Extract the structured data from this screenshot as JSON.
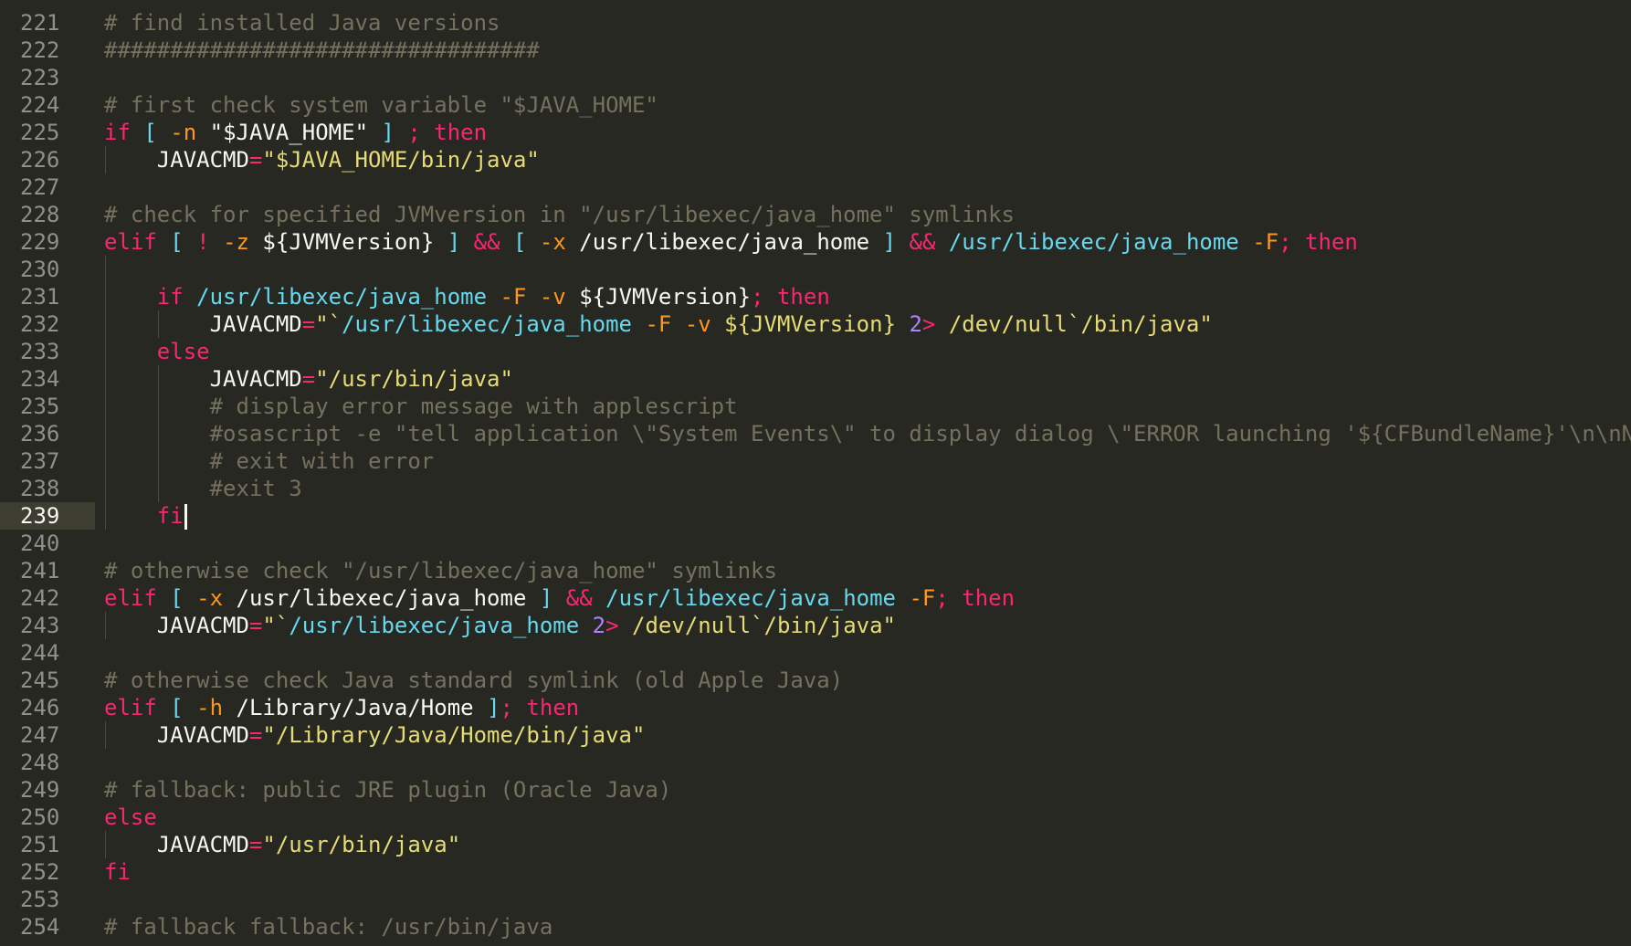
{
  "colors": {
    "background": "#272822",
    "gutter_text": "#90908a",
    "gutter_active_bg": "#3e3d32",
    "comment": "#75715e",
    "keyword": "#f92672",
    "string": "#e6db74",
    "command": "#66d9ef",
    "option": "#fd971f",
    "number": "#ae81ff",
    "plain": "#f8f8f2"
  },
  "editor": {
    "active_line": 239,
    "lines": [
      {
        "n": "221",
        "indent": 0,
        "guides": [],
        "tokens": [
          {
            "t": "# find installed Java versions",
            "c": "comment"
          }
        ]
      },
      {
        "n": "222",
        "indent": 0,
        "guides": [],
        "tokens": [
          {
            "t": "#################################",
            "c": "comment"
          }
        ]
      },
      {
        "n": "223",
        "indent": 0,
        "guides": [],
        "tokens": []
      },
      {
        "n": "224",
        "indent": 0,
        "guides": [],
        "tokens": [
          {
            "t": "# first check system variable \"$JAVA_HOME\"",
            "c": "comment"
          }
        ]
      },
      {
        "n": "225",
        "indent": 0,
        "guides": [],
        "tokens": [
          {
            "t": "if",
            "c": "keyword"
          },
          {
            "t": " "
          },
          {
            "t": "[",
            "c": "command"
          },
          {
            "t": " "
          },
          {
            "t": "-n",
            "c": "option"
          },
          {
            "t": " "
          },
          {
            "t": "\"$JAVA_HOME\"",
            "c": "plain"
          },
          {
            "t": " "
          },
          {
            "t": "]",
            "c": "command"
          },
          {
            "t": " "
          },
          {
            "t": ";",
            "c": "keyword"
          },
          {
            "t": " "
          },
          {
            "t": "then",
            "c": "keyword"
          }
        ]
      },
      {
        "n": "226",
        "indent": 1,
        "guides": [
          0
        ],
        "tokens": [
          {
            "t": "JAVACMD",
            "c": "plain"
          },
          {
            "t": "=",
            "c": "keyword"
          },
          {
            "t": "\"$JAVA_HOME/bin/java\"",
            "c": "string"
          }
        ]
      },
      {
        "n": "227",
        "indent": 0,
        "guides": [],
        "tokens": []
      },
      {
        "n": "228",
        "indent": 0,
        "guides": [],
        "tokens": [
          {
            "t": "# check for specified JVMversion in \"/usr/libexec/java_home\" symlinks",
            "c": "comment"
          }
        ]
      },
      {
        "n": "229",
        "indent": 0,
        "guides": [],
        "tokens": [
          {
            "t": "elif",
            "c": "keyword"
          },
          {
            "t": " "
          },
          {
            "t": "[",
            "c": "command"
          },
          {
            "t": " "
          },
          {
            "t": "!",
            "c": "keyword"
          },
          {
            "t": " "
          },
          {
            "t": "-z",
            "c": "option"
          },
          {
            "t": " "
          },
          {
            "t": "${JVMVersion}",
            "c": "plain"
          },
          {
            "t": " "
          },
          {
            "t": "]",
            "c": "command"
          },
          {
            "t": " "
          },
          {
            "t": "&&",
            "c": "keyword"
          },
          {
            "t": " "
          },
          {
            "t": "[",
            "c": "command"
          },
          {
            "t": " "
          },
          {
            "t": "-x",
            "c": "option"
          },
          {
            "t": " "
          },
          {
            "t": "/usr/libexec/java_home",
            "c": "plain"
          },
          {
            "t": " "
          },
          {
            "t": "]",
            "c": "command"
          },
          {
            "t": " "
          },
          {
            "t": "&&",
            "c": "keyword"
          },
          {
            "t": " "
          },
          {
            "t": "/usr/libexec/java_home",
            "c": "command"
          },
          {
            "t": " "
          },
          {
            "t": "-F",
            "c": "option"
          },
          {
            "t": ";",
            "c": "keyword"
          },
          {
            "t": " "
          },
          {
            "t": "then",
            "c": "keyword"
          }
        ]
      },
      {
        "n": "230",
        "indent": 0,
        "guides": [
          0
        ],
        "tokens": []
      },
      {
        "n": "231",
        "indent": 1,
        "guides": [
          0
        ],
        "tokens": [
          {
            "t": "if",
            "c": "keyword"
          },
          {
            "t": " "
          },
          {
            "t": "/usr/libexec/java_home",
            "c": "command"
          },
          {
            "t": " "
          },
          {
            "t": "-F",
            "c": "option"
          },
          {
            "t": " "
          },
          {
            "t": "-v",
            "c": "option"
          },
          {
            "t": " "
          },
          {
            "t": "${JVMVersion}",
            "c": "plain"
          },
          {
            "t": ";",
            "c": "keyword"
          },
          {
            "t": " "
          },
          {
            "t": "then",
            "c": "keyword"
          }
        ]
      },
      {
        "n": "232",
        "indent": 2,
        "guides": [
          0,
          1
        ],
        "tokens": [
          {
            "t": "JAVACMD",
            "c": "plain"
          },
          {
            "t": "=",
            "c": "keyword"
          },
          {
            "t": "\"`",
            "c": "string"
          },
          {
            "t": "/usr/libexec/java_home",
            "c": "command"
          },
          {
            "t": " "
          },
          {
            "t": "-F",
            "c": "option"
          },
          {
            "t": " "
          },
          {
            "t": "-v",
            "c": "option"
          },
          {
            "t": " "
          },
          {
            "t": "${JVMVersion}",
            "c": "string"
          },
          {
            "t": " "
          },
          {
            "t": "2",
            "c": "number"
          },
          {
            "t": ">",
            "c": "keyword"
          },
          {
            "t": " "
          },
          {
            "t": "/dev/null`/bin/java\"",
            "c": "string"
          }
        ]
      },
      {
        "n": "233",
        "indent": 1,
        "guides": [
          0
        ],
        "tokens": [
          {
            "t": "else",
            "c": "keyword"
          }
        ]
      },
      {
        "n": "234",
        "indent": 2,
        "guides": [
          0,
          1
        ],
        "tokens": [
          {
            "t": "JAVACMD",
            "c": "plain"
          },
          {
            "t": "=",
            "c": "keyword"
          },
          {
            "t": "\"/usr/bin/java\"",
            "c": "string"
          }
        ]
      },
      {
        "n": "235",
        "indent": 2,
        "guides": [
          0,
          1
        ],
        "tokens": [
          {
            "t": "# display error message with applescript",
            "c": "comment"
          }
        ]
      },
      {
        "n": "236",
        "indent": 2,
        "guides": [
          0,
          1
        ],
        "tokens": [
          {
            "t": "#osascript -e \"tell application \\\"System Events\\\" to display dialog \\\"ERROR launching '${CFBundleName}'\\n\\nNo su",
            "c": "comment"
          }
        ]
      },
      {
        "n": "237",
        "indent": 2,
        "guides": [
          0,
          1
        ],
        "tokens": [
          {
            "t": "# exit with error",
            "c": "comment"
          }
        ]
      },
      {
        "n": "238",
        "indent": 2,
        "guides": [
          0,
          1
        ],
        "tokens": [
          {
            "t": "#exit 3",
            "c": "comment"
          }
        ]
      },
      {
        "n": "239",
        "indent": 1,
        "guides": [
          0
        ],
        "cursor": true,
        "tokens": [
          {
            "t": "fi",
            "c": "keyword"
          }
        ]
      },
      {
        "n": "240",
        "indent": 0,
        "guides": [],
        "tokens": []
      },
      {
        "n": "241",
        "indent": 0,
        "guides": [],
        "tokens": [
          {
            "t": "# otherwise check \"/usr/libexec/java_home\" symlinks",
            "c": "comment"
          }
        ]
      },
      {
        "n": "242",
        "indent": 0,
        "guides": [],
        "tokens": [
          {
            "t": "elif",
            "c": "keyword"
          },
          {
            "t": " "
          },
          {
            "t": "[",
            "c": "command"
          },
          {
            "t": " "
          },
          {
            "t": "-x",
            "c": "option"
          },
          {
            "t": " "
          },
          {
            "t": "/usr/libexec/java_home",
            "c": "plain"
          },
          {
            "t": " "
          },
          {
            "t": "]",
            "c": "command"
          },
          {
            "t": " "
          },
          {
            "t": "&&",
            "c": "keyword"
          },
          {
            "t": " "
          },
          {
            "t": "/usr/libexec/java_home",
            "c": "command"
          },
          {
            "t": " "
          },
          {
            "t": "-F",
            "c": "option"
          },
          {
            "t": ";",
            "c": "keyword"
          },
          {
            "t": " "
          },
          {
            "t": "then",
            "c": "keyword"
          }
        ]
      },
      {
        "n": "243",
        "indent": 1,
        "guides": [
          0
        ],
        "tokens": [
          {
            "t": "JAVACMD",
            "c": "plain"
          },
          {
            "t": "=",
            "c": "keyword"
          },
          {
            "t": "\"`",
            "c": "string"
          },
          {
            "t": "/usr/libexec/java_home",
            "c": "command"
          },
          {
            "t": " "
          },
          {
            "t": "2",
            "c": "number"
          },
          {
            "t": ">",
            "c": "keyword"
          },
          {
            "t": " "
          },
          {
            "t": "/dev/null`/bin/java\"",
            "c": "string"
          }
        ]
      },
      {
        "n": "244",
        "indent": 0,
        "guides": [],
        "tokens": []
      },
      {
        "n": "245",
        "indent": 0,
        "guides": [],
        "tokens": [
          {
            "t": "# otherwise check Java standard symlink (old Apple Java)",
            "c": "comment"
          }
        ]
      },
      {
        "n": "246",
        "indent": 0,
        "guides": [],
        "tokens": [
          {
            "t": "elif",
            "c": "keyword"
          },
          {
            "t": " "
          },
          {
            "t": "[",
            "c": "command"
          },
          {
            "t": " "
          },
          {
            "t": "-h",
            "c": "option"
          },
          {
            "t": " "
          },
          {
            "t": "/Library/Java/Home",
            "c": "plain"
          },
          {
            "t": " "
          },
          {
            "t": "]",
            "c": "command"
          },
          {
            "t": ";",
            "c": "keyword"
          },
          {
            "t": " "
          },
          {
            "t": "then",
            "c": "keyword"
          }
        ]
      },
      {
        "n": "247",
        "indent": 1,
        "guides": [
          0
        ],
        "tokens": [
          {
            "t": "JAVACMD",
            "c": "plain"
          },
          {
            "t": "=",
            "c": "keyword"
          },
          {
            "t": "\"/Library/Java/Home/bin/java\"",
            "c": "string"
          }
        ]
      },
      {
        "n": "248",
        "indent": 0,
        "guides": [],
        "tokens": []
      },
      {
        "n": "249",
        "indent": 0,
        "guides": [],
        "tokens": [
          {
            "t": "# fallback: public JRE plugin (Oracle Java)",
            "c": "comment"
          }
        ]
      },
      {
        "n": "250",
        "indent": 0,
        "guides": [],
        "tokens": [
          {
            "t": "else",
            "c": "keyword"
          }
        ]
      },
      {
        "n": "251",
        "indent": 1,
        "guides": [
          0
        ],
        "tokens": [
          {
            "t": "JAVACMD",
            "c": "plain"
          },
          {
            "t": "=",
            "c": "keyword"
          },
          {
            "t": "\"/usr/bin/java\"",
            "c": "string"
          }
        ]
      },
      {
        "n": "252",
        "indent": 0,
        "guides": [],
        "tokens": [
          {
            "t": "fi",
            "c": "keyword"
          }
        ]
      },
      {
        "n": "253",
        "indent": 0,
        "guides": [],
        "tokens": []
      },
      {
        "n": "254",
        "indent": 0,
        "guides": [],
        "tokens": [
          {
            "t": "# fallback fallback: /usr/bin/java",
            "c": "comment"
          }
        ]
      }
    ]
  }
}
